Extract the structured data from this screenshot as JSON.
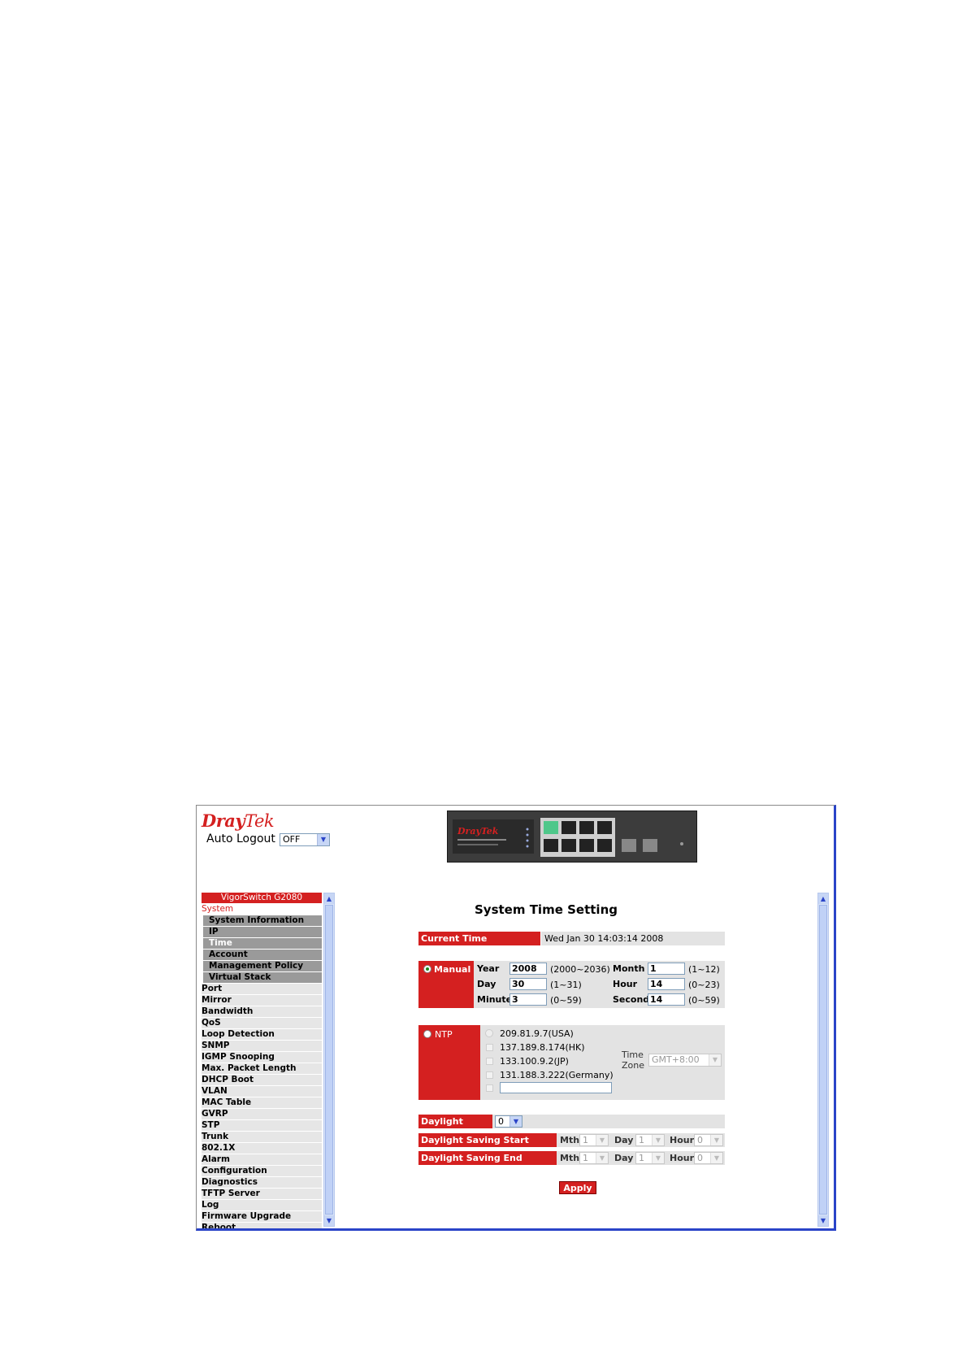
{
  "brand": {
    "logo_part1": "Dray",
    "logo_part2": "Tek"
  },
  "header": {
    "auto_logout_label": "Auto Logout",
    "auto_logout_value": "OFF"
  },
  "sidebar": {
    "title": "VigorSwitch G2080",
    "section": "System",
    "sub_items": [
      "System Information",
      "IP",
      "Time",
      "Account",
      "Management Policy",
      "Virtual Stack"
    ],
    "items": [
      "Port",
      "Mirror",
      "Bandwidth",
      "QoS",
      "Loop Detection",
      "SNMP",
      "IGMP Snooping",
      "Max. Packet Length",
      "DHCP Boot",
      "VLAN",
      "MAC Table",
      "GVRP",
      "STP",
      "Trunk",
      "802.1X",
      "Alarm",
      "Configuration",
      "Diagnostics",
      "TFTP Server",
      "Log",
      "Firmware Upgrade",
      "Reboot"
    ]
  },
  "main": {
    "title": "System Time Setting",
    "current_time_label": "Current Time",
    "current_time_value": "Wed Jan 30 14:03:14 2008",
    "manual": {
      "label": "Manual",
      "year_label": "Year",
      "year_value": "2008",
      "year_range": "(2000~2036)",
      "month_label": "Month",
      "month_value": "1",
      "month_range": "(1~12)",
      "day_label": "Day",
      "day_value": "30",
      "day_range": "(1~31)",
      "hour_label": "Hour",
      "hour_value": "14",
      "hour_range": "(0~23)",
      "minute_label": "Minute",
      "minute_value": "3",
      "minute_range": "(0~59)",
      "second_label": "Second",
      "second_value": "14",
      "second_range": "(0~59)"
    },
    "ntp": {
      "label": "NTP",
      "servers": [
        "209.81.9.7(USA)",
        "137.189.8.174(HK)",
        "133.100.9.2(JP)",
        "131.188.3.222(Germany)"
      ],
      "custom_value": "",
      "time_zone_label_1": "Time",
      "time_zone_label_2": "Zone",
      "time_zone_value": "GMT+8:00"
    },
    "daylight": {
      "saving_label": "Daylight Saving",
      "saving_value": "0",
      "start_label": "Daylight Saving Start",
      "end_label": "Daylight Saving End",
      "mth_label": "Mth",
      "day_label": "Day",
      "hour_label": "Hour",
      "start_mth": "1",
      "start_day": "1",
      "start_hour": "0",
      "end_mth": "1",
      "end_day": "1",
      "end_hour": "0"
    },
    "apply_label": "Apply"
  }
}
